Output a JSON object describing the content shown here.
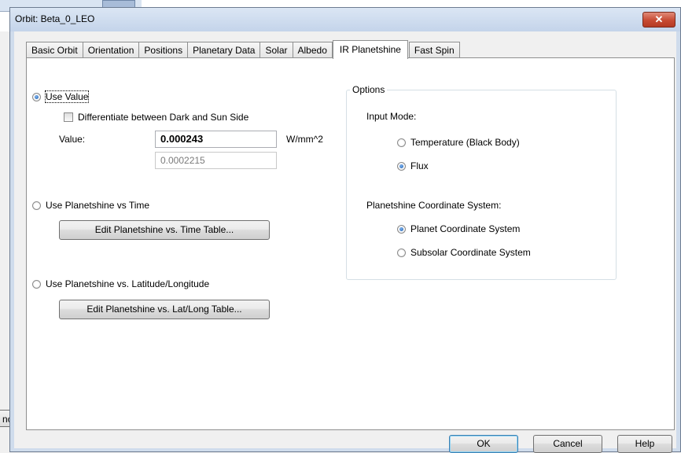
{
  "background": {
    "cancel_fragment": "ncel"
  },
  "dialog": {
    "title": "Orbit: Beta_0_LEO",
    "close_glyph": "✕"
  },
  "tabs": [
    {
      "label": "Basic Orbit",
      "active": false
    },
    {
      "label": "Orientation",
      "active": false
    },
    {
      "label": "Positions",
      "active": false
    },
    {
      "label": "Planetary Data",
      "active": false
    },
    {
      "label": "Solar",
      "active": false
    },
    {
      "label": "Albedo",
      "active": false
    },
    {
      "label": "IR Planetshine",
      "active": true
    },
    {
      "label": "Fast Spin",
      "active": false
    }
  ],
  "ir_planetshine": {
    "use_value_label": "Use Value",
    "use_value_selected": true,
    "differentiate_label": "Differentiate between Dark and Sun Side",
    "differentiate_checked": false,
    "value_label": "Value:",
    "value": "0.000243",
    "value_units": "W/mm^2",
    "secondary_value": "0.0002215",
    "use_vs_time_label": "Use Planetshine vs Time",
    "edit_vs_time_button": "Edit Planetshine vs. Time Table...",
    "use_vs_latlong_label": "Use Planetshine vs. Latitude/Longitude",
    "edit_vs_latlong_button": "Edit Planetshine vs. Lat/Long Table..."
  },
  "options": {
    "group_title": "Options",
    "input_mode_label": "Input Mode:",
    "temperature_label": "Temperature (Black Body)",
    "flux_label": "Flux",
    "input_mode_selected": "Flux",
    "coord_system_label": "Planetshine Coordinate System:",
    "planet_coord_label": "Planet Coordinate System",
    "subsolar_coord_label": "Subsolar Coordinate System",
    "coord_selected": "Planet Coordinate System"
  },
  "buttons": {
    "ok": "OK",
    "cancel": "Cancel",
    "help": "Help"
  }
}
